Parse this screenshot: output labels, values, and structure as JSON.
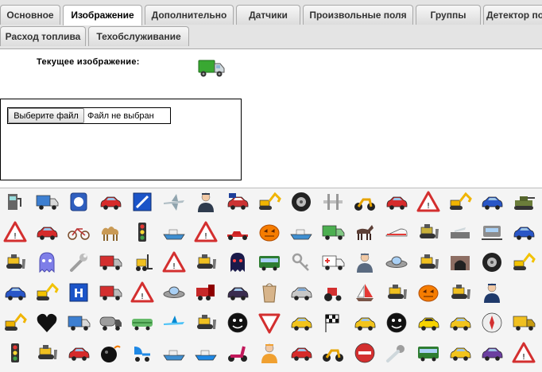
{
  "tabs": [
    "Основное",
    "Изображение",
    "Дополнительно",
    "Датчики",
    "Произвольные поля",
    "Группы",
    "Детектор по",
    "Расход топлива",
    "Техобслуживание"
  ],
  "active_tab": "Изображение",
  "current_image": {
    "label": "Текущее изображение:",
    "icon": "green-truck-icon"
  },
  "file_input": {
    "button_label": "Выберите файл",
    "status": "Файл не выбран"
  },
  "icons": [
    [
      "gas-station",
      "blue-truck",
      "blue-badge",
      "red-car",
      "blue-square-sign",
      "jet-plane",
      "pilot-person",
      "usa-flag-car",
      "excavator",
      "tire",
      "pier",
      "motorcycle",
      "red-car",
      "road-warning-sign",
      "excavator",
      "blue-car",
      "army-tank"
    ],
    [
      "warning-sign",
      "red-car",
      "bicycle",
      "camel",
      "traffic-light",
      "boat",
      "warning-sign",
      "formula-car",
      "pumpkin",
      "boat",
      "green-van",
      "horse",
      "bullet-train",
      "tracked-vehicle",
      "airport",
      "tram",
      "blue-car"
    ],
    [
      "bulldozer",
      "ghost",
      "wrench",
      "truck",
      "forklift",
      "warning-sign",
      "bulldozer",
      "pacman-ghost",
      "bus",
      "keys",
      "ambulance",
      "driver-person",
      "ufo",
      "bulldozer",
      "tunnel",
      "tire",
      "crane"
    ],
    [
      "blue-car",
      "crane",
      "hospital-sign",
      "truck",
      "warning-sign",
      "ufo",
      "locomotive",
      "dark-car",
      "paper-bag",
      "silver-car",
      "tractor",
      "sailboat",
      "bulldozer",
      "pumpkin",
      "bulldozer",
      "officer-person"
    ],
    [
      "excavator",
      "heart",
      "blue-truck",
      "tank-truck",
      "train",
      "plane",
      "bulldozer",
      "smiley-face",
      "yield-sign",
      "yellow-car",
      "checkered-flags",
      "yellow-car",
      "smiley-face",
      "yellow-taxi",
      "yellow-car",
      "compass",
      "dump-truck"
    ],
    [
      "traffic-light",
      "bulldozer",
      "red-car",
      "bomb",
      "baby-stroller",
      "boat",
      "jet-ski",
      "scooter",
      "worker-person",
      "red-car",
      "motorcycle",
      "no-entry-sign",
      "comet",
      "bus",
      "yellow-car",
      "purple-car",
      "warning-sign"
    ]
  ]
}
